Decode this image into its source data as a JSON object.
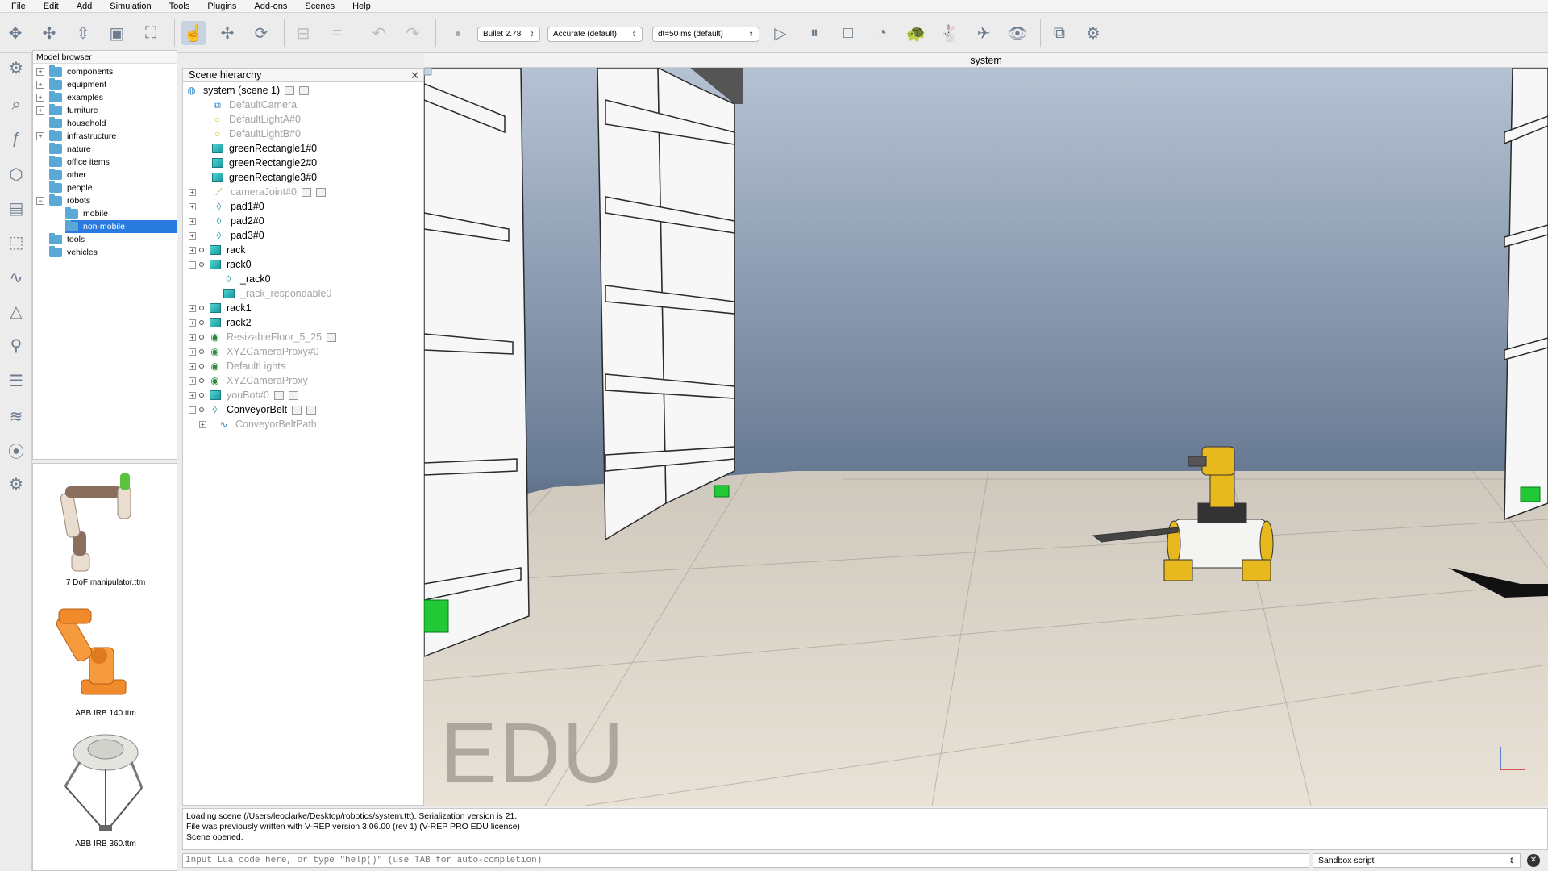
{
  "menu": [
    "File",
    "Edit",
    "Add",
    "Simulation",
    "Tools",
    "Plugins",
    "Add-ons",
    "Scenes",
    "Help"
  ],
  "toolbar": {
    "engine": "Bullet 2.78",
    "accuracy": "Accurate (default)",
    "timestep": "dt=50 ms (default)"
  },
  "model_browser": {
    "title": "Model browser",
    "items": [
      "components",
      "equipment",
      "examples",
      "furniture",
      "household",
      "infrastructure",
      "nature",
      "office items",
      "other",
      "people",
      "robots",
      "mobile",
      "non-mobile",
      "tools",
      "vehicles"
    ],
    "thumbnails": [
      "7 DoF manipulator.ttm",
      "ABB IRB 140.ttm",
      "ABB IRB 360.ttm"
    ]
  },
  "scene_hierarchy": {
    "title": "Scene hierarchy",
    "items": [
      "system (scene 1)",
      "DefaultCamera",
      "DefaultLightA#0",
      "DefaultLightB#0",
      "greenRectangle1#0",
      "greenRectangle2#0",
      "greenRectangle3#0",
      "cameraJoint#0",
      "pad1#0",
      "pad2#0",
      "pad3#0",
      "rack",
      "rack0",
      "_rack0",
      "_rack_respondable0",
      "rack1",
      "rack2",
      "ResizableFloor_5_25",
      "XYZCameraProxy#0",
      "DefaultLights",
      "XYZCameraProxy",
      "youBot#0",
      "ConveyorBelt",
      "ConveyorBeltPath"
    ]
  },
  "viewport": {
    "title": "system",
    "watermark": "EDU"
  },
  "console": {
    "lines": [
      "Loading scene (/Users/leoclarke/Desktop/robotics/system.ttt).  Serialization version is 21.",
      "File was previously written with V-REP version 3.06.00 (rev 1) (V-REP PRO EDU license)",
      "Scene opened."
    ]
  },
  "lua": {
    "placeholder": "Input Lua code here, or type \"help()\" (use TAB for auto-completion)",
    "script": "Sandbox script"
  }
}
